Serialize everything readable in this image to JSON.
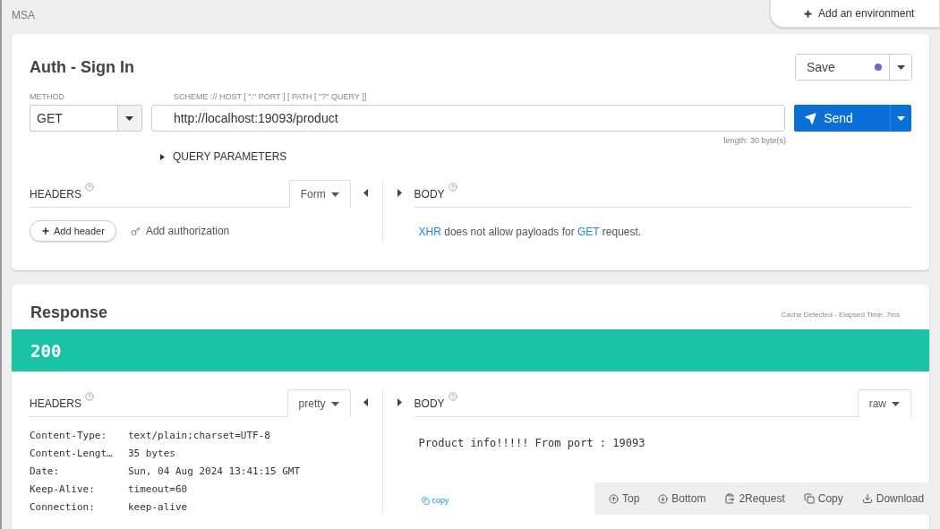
{
  "project": "MSA",
  "environment_button": "Add an environment",
  "request": {
    "title": "Auth - Sign In",
    "save": {
      "label": "Save",
      "unsaved": true
    },
    "method_label": "METHOD",
    "method": "GET",
    "url_label": "SCHEME :// HOST [ \":\" PORT ] [ PATH [ \"?\" QUERY ]]",
    "url": "http://localhost:19093/product",
    "length": "length: 30 byte(s)",
    "send": "Send",
    "query_parameters": {
      "label": "QUERY PARAMETERS",
      "expanded": false
    },
    "headers": {
      "label": "HEADERS",
      "mode": "Form",
      "add_header": "Add header",
      "add_authorization": "Add authorization"
    },
    "body": {
      "label": "BODY",
      "message": [
        {
          "kind": "link",
          "text": "XHR"
        },
        {
          "kind": "plain",
          "text": " does not allow payloads for "
        },
        {
          "kind": "link",
          "text": "GET"
        },
        {
          "kind": "plain",
          "text": " request."
        }
      ]
    }
  },
  "response": {
    "title": "Response",
    "timing": "Cache Detected - Elapsed Time: 7ms",
    "status": "200",
    "headers": {
      "label": "HEADERS",
      "mode": "pretty",
      "rows": [
        {
          "name": "Content-Type:",
          "value": "text/plain;charset=UTF-8"
        },
        {
          "name": "Content-Lengt…",
          "value": "35 bytes"
        },
        {
          "name": "Date:",
          "value": "Sun, 04 Aug 2024 13:41:15 GMT"
        },
        {
          "name": "Keep-Alive:",
          "value": "timeout=60"
        },
        {
          "name": "Connection:",
          "value": "keep-alive"
        }
      ]
    },
    "body": {
      "label": "BODY",
      "mode": "raw",
      "text": "Product info!!!!! From port : 19093",
      "copy": "copy"
    },
    "toolbar": [
      {
        "kind": "top",
        "label": "Top"
      },
      {
        "kind": "bottom",
        "label": "Bottom"
      },
      {
        "kind": "to-request",
        "label": "2Request"
      },
      {
        "kind": "copy",
        "label": "Copy"
      },
      {
        "kind": "download",
        "label": "Download"
      }
    ]
  }
}
